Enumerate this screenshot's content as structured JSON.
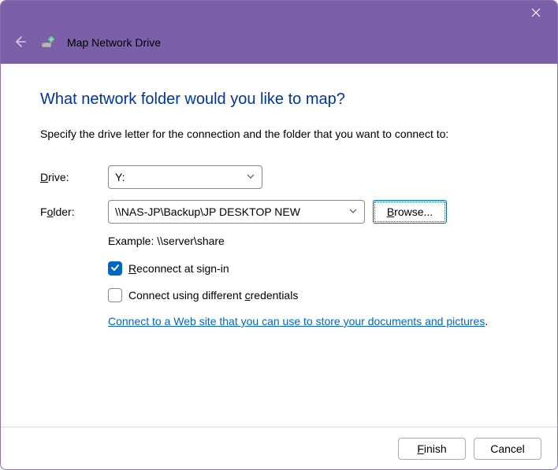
{
  "titlebar": {
    "close_icon": "close"
  },
  "header": {
    "back_icon": "back-arrow",
    "title": "Map Network Drive"
  },
  "content": {
    "heading": "What network folder would you like to map?",
    "instruction": "Specify the drive letter for the connection and the folder that you want to connect to:",
    "drive": {
      "label_u": "D",
      "label_rest": "rive:",
      "value": "Y:"
    },
    "folder": {
      "label_u": "o",
      "label_pre": "F",
      "label_rest": "lder:",
      "value": "\\\\NAS-JP\\Backup\\JP DESKTOP NEW",
      "browse_u": "B",
      "browse_rest": "rowse..."
    },
    "example": "Example: \\\\server\\share",
    "reconnect": {
      "checked": true,
      "label_u": "R",
      "label_rest": "econnect at sign-in"
    },
    "different_creds": {
      "checked": false,
      "label_pre": "Connect using different ",
      "label_u": "c",
      "label_rest": "redentials"
    },
    "link": "Connect to a Web site that you can use to store your documents and pictures"
  },
  "footer": {
    "finish_u": "F",
    "finish_rest": "inish",
    "cancel": "Cancel"
  }
}
